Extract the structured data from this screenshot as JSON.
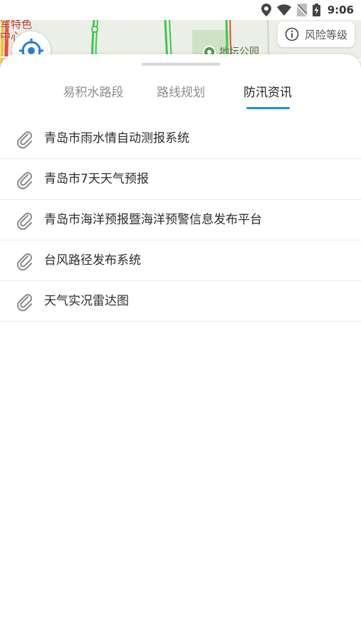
{
  "status_bar": {
    "time": "9:06",
    "icons": [
      "location-icon",
      "wifi-icon",
      "no-sim-icon",
      "battery-charging-icon"
    ]
  },
  "map": {
    "label_poi_left": "军特色中心",
    "label_park": "地坛公园",
    "risk_button_label": "风险等级",
    "risk_icon": "info-icon",
    "locate_icon": "locate-crosshair-icon"
  },
  "tabs": [
    {
      "label": "易积水路段",
      "active": false
    },
    {
      "label": "路线规划",
      "active": false
    },
    {
      "label": "防汛资讯",
      "active": true
    }
  ],
  "colors": {
    "accent": "#1e8fe0",
    "tab_inactive": "#8c8c8c",
    "tab_active": "#222222",
    "locate_blue": "#2a7fd6"
  },
  "links": [
    {
      "icon": "paperclip-icon",
      "label": "青岛市雨水情自动测报系统"
    },
    {
      "icon": "paperclip-icon",
      "label": "青岛市7天天气预报"
    },
    {
      "icon": "paperclip-icon",
      "label": "青岛市海洋预报暨海洋预警信息发布平台"
    },
    {
      "icon": "paperclip-icon",
      "label": "台风路径发布系统"
    },
    {
      "icon": "paperclip-icon",
      "label": "天气实况雷达图"
    }
  ]
}
